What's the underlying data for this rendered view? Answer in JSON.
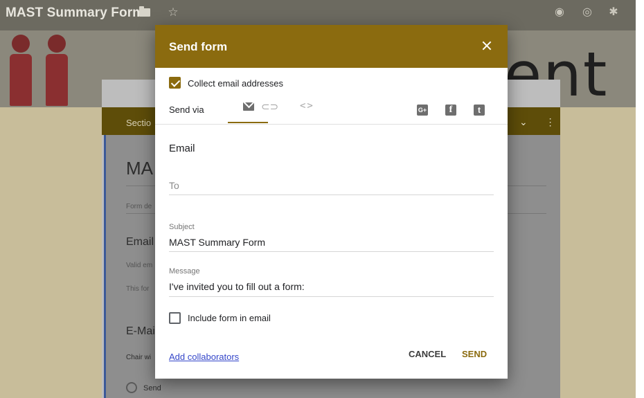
{
  "app": {
    "title": "MAST Summary Form",
    "header_text": "ent",
    "folder_icon": "folder-icon",
    "star_icon": "star-icon",
    "palette_icon": "palette-icon",
    "preview_icon": "eye-icon",
    "settings_icon": "gear-icon"
  },
  "background_form": {
    "section_label": "Sectio",
    "form_title": "MA",
    "form_description": "Form de",
    "q1_title": "Email",
    "q1_hint": "Valid em",
    "q1_note": "This for",
    "q2_title": "E-Mai",
    "q2_desc": "Chair wi",
    "option": "Send"
  },
  "dialog": {
    "title": "Send form",
    "collect_email": {
      "label": "Collect email addresses",
      "checked": true
    },
    "send_via_label": "Send via",
    "via_tabs": [
      {
        "name": "email",
        "icon": "mail-icon",
        "active": true
      },
      {
        "name": "link",
        "icon": "link-icon",
        "active": false
      },
      {
        "name": "embed",
        "icon": "embed-icon",
        "active": false
      }
    ],
    "social": [
      {
        "name": "google-plus",
        "glyph": "G+"
      },
      {
        "name": "facebook",
        "glyph": "f"
      },
      {
        "name": "twitter",
        "glyph": "t"
      }
    ],
    "section_title": "Email",
    "to": {
      "placeholder": "To",
      "value": ""
    },
    "subject": {
      "label": "Subject",
      "value": "MAST Summary Form"
    },
    "message": {
      "label": "Message",
      "value": "I've invited you to fill out a form:"
    },
    "include_form": {
      "label": "Include form in email",
      "checked": false
    },
    "add_collaborators": "Add collaborators",
    "cancel": "CANCEL",
    "send": "SEND"
  },
  "colors": {
    "accent": "#8b6b0f",
    "link": "#3446c9"
  }
}
